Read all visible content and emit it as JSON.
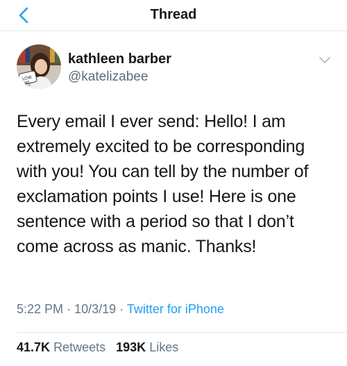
{
  "header": {
    "title": "Thread",
    "back_icon": "chevron-left-icon"
  },
  "author": {
    "name": "kathleen barber",
    "handle": "@katelizabee",
    "avatar_sign_text": "LOW ME"
  },
  "tweet": {
    "text": "Every email I ever send: Hello! I am extremely excited to be corresponding with you! You can tell by the number of exclamation points I use! Here is one sentence with a period so that I don’t come across as manic. Thanks!",
    "time": "5:22 PM",
    "separator": "·",
    "date": "10/3/19",
    "source": "Twitter for iPhone"
  },
  "stats": {
    "retweets_count": "41.7K",
    "retweets_label": "Retweets",
    "likes_count": "193K",
    "likes_label": "Likes"
  },
  "colors": {
    "accent": "#1da1f2",
    "text_primary": "#14171a",
    "text_secondary": "#657786",
    "divider": "#e1e8ed"
  }
}
